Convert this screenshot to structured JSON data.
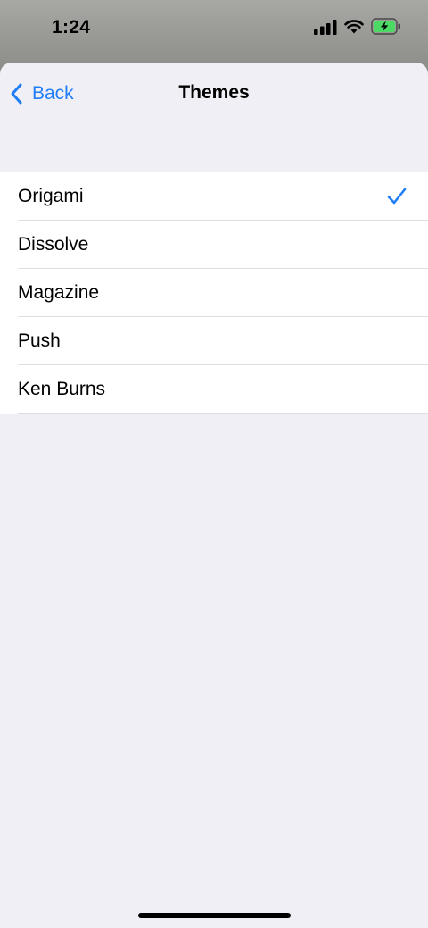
{
  "status_bar": {
    "time": "1:24",
    "icons": [
      "signal-icon",
      "wifi-icon",
      "battery-charging-icon"
    ]
  },
  "nav": {
    "back_label": "Back",
    "title": "Themes"
  },
  "themes": [
    {
      "label": "Origami",
      "selected": true
    },
    {
      "label": "Dissolve",
      "selected": false
    },
    {
      "label": "Magazine",
      "selected": false
    },
    {
      "label": "Push",
      "selected": false
    },
    {
      "label": "Ken Burns",
      "selected": false
    }
  ],
  "colors": {
    "accent": "#1f7ef7",
    "background": "#f0eff5",
    "battery_fill": "#4cd964"
  }
}
